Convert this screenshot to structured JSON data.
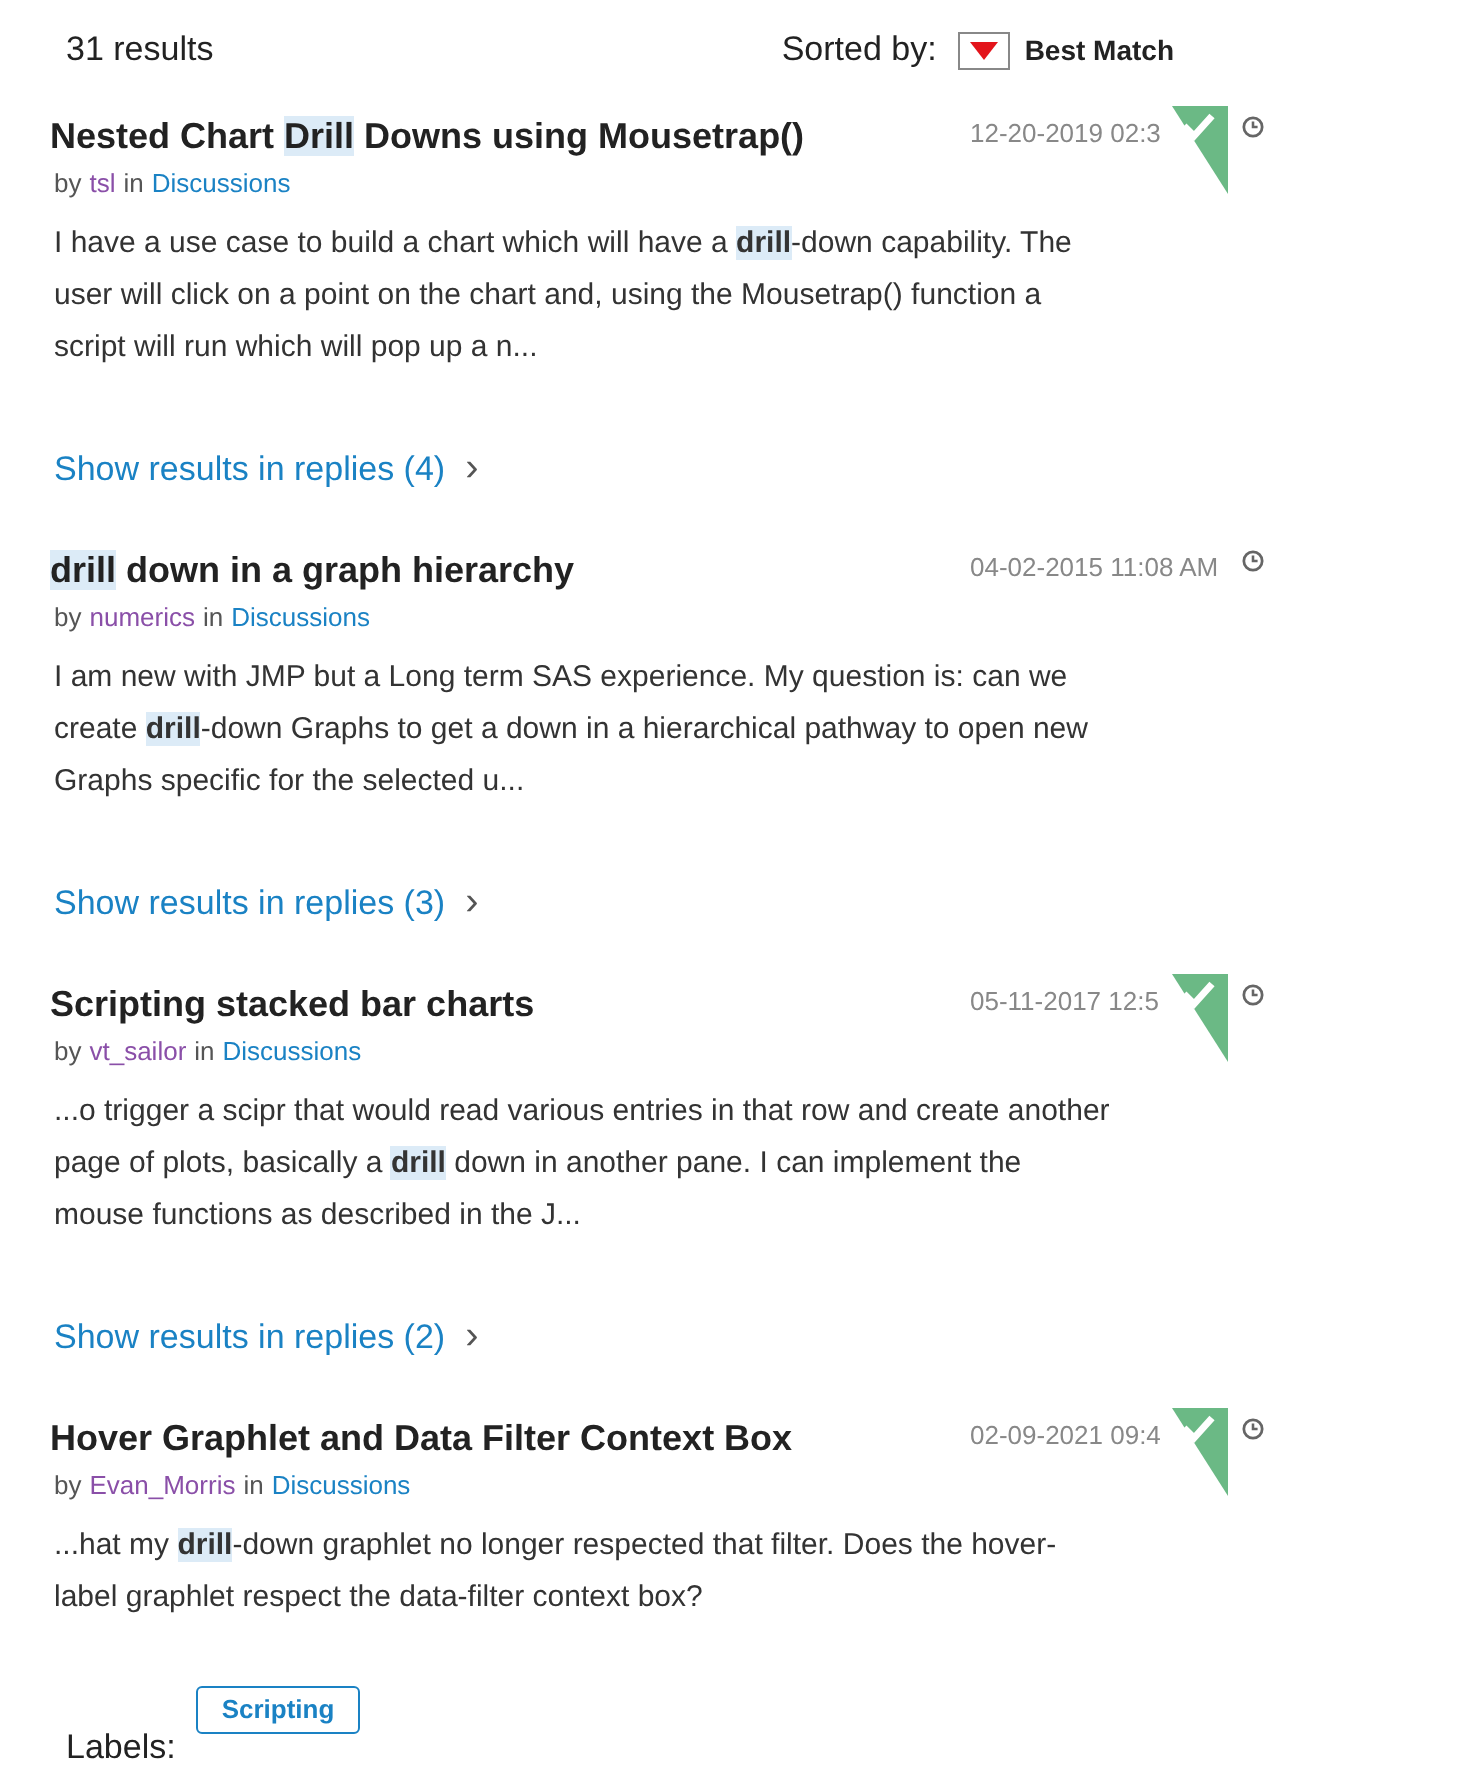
{
  "results_count": "31 results",
  "sort": {
    "label": "Sorted by:",
    "value": "Best Match"
  },
  "results": [
    {
      "title": [
        {
          "text": "Nested Chart ",
          "highlight": false
        },
        {
          "text": "Drill",
          "highlight": true
        },
        {
          "text": " Downs using Mousetrap()",
          "highlight": false
        }
      ],
      "by": "by",
      "author": "tsl",
      "in": "in",
      "board": "Discussions",
      "date": "12-20-2019 02:3",
      "solved": true,
      "body": [
        {
          "text": "I have a use case to build a chart which will have a ",
          "highlight": false
        },
        {
          "text": "drill",
          "highlight": true
        },
        {
          "text": "-down capability. The user will click on a point on the chart and, using the Mousetrap() function a script will run which will pop up a n...",
          "highlight": false
        }
      ],
      "replies": "Show results in replies (4)",
      "chevron": "›"
    },
    {
      "title": [
        {
          "text": "drill",
          "highlight": true
        },
        {
          "text": " down in a graph hierarchy",
          "highlight": false
        }
      ],
      "by": "by",
      "author": "numerics",
      "in": "in",
      "board": "Discussions",
      "date": "04-02-2015 11:08 AM",
      "solved": false,
      "body": [
        {
          "text": "I am new with JMP but a Long term SAS experience. My question is: can we create ",
          "highlight": false
        },
        {
          "text": "drill",
          "highlight": true
        },
        {
          "text": "-down Graphs  to get a down in a hierarchical pathway to open new Graphs specific for the selected u...",
          "highlight": false
        }
      ],
      "replies": "Show results in replies (3)",
      "chevron": "›"
    },
    {
      "title": [
        {
          "text": "Scripting stacked bar charts",
          "highlight": false
        }
      ],
      "by": "by",
      "author": "vt_sailor",
      "in": "in",
      "board": "Discussions",
      "date": "05-11-2017 12:5",
      "solved": true,
      "body": [
        {
          "text": "...o trigger a scipr that would read various entries in that row and create another page of plots, basically a ",
          "highlight": false
        },
        {
          "text": "drill",
          "highlight": true
        },
        {
          "text": " down in another pane.  I can implement the mouse functions as described in the J...",
          "highlight": false
        }
      ],
      "replies": "Show results in replies (2)",
      "chevron": "›"
    },
    {
      "title": [
        {
          "text": "Hover Graphlet and Data Filter Context Box",
          "highlight": false
        }
      ],
      "by": "by",
      "author": "Evan_Morris",
      "in": "in",
      "board": "Discussions",
      "date": "02-09-2021 09:4",
      "solved": true,
      "body": [
        {
          "text": "...hat my ",
          "highlight": false
        },
        {
          "text": "drill",
          "highlight": true
        },
        {
          "text": "-down graphlet no longer respected that filter.   Does the hover-label graphlet respect the data-filter context box?",
          "highlight": false
        }
      ]
    }
  ],
  "labels": {
    "label": "Labels:",
    "tags": [
      "Scripting"
    ]
  }
}
